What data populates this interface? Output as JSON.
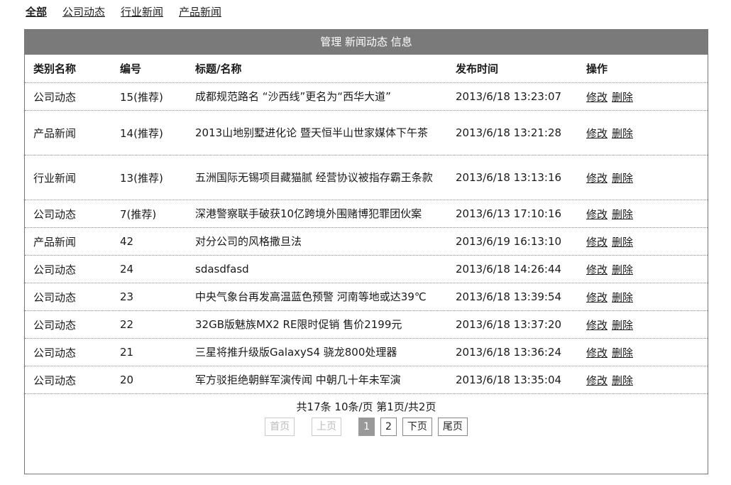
{
  "tabs": [
    "全部",
    "公司动态",
    "行业新闻",
    "产品新闻"
  ],
  "panel_title": "管理 新闻动态 信息",
  "columns": {
    "category": "类别名称",
    "id": "编号",
    "title": "标题/名称",
    "time": "发布时间",
    "ops": "操作"
  },
  "rows": [
    {
      "category": "公司动态",
      "id": "15(推荐)",
      "title": "成都规范路名 “沙西线”更名为“西华大道”",
      "time": "2013/6/18 13:23:07",
      "edit": "修改",
      "delete": "删除"
    },
    {
      "category": "产品新闻",
      "id": "14(推荐)",
      "title": "2013山地别墅进化论 暨天恒半山世家媒体下午茶",
      "time": "2013/6/18 13:21:28",
      "edit": "修改",
      "delete": "删除"
    },
    {
      "category": "行业新闻",
      "id": "13(推荐)",
      "title": "五洲国际无锡项目藏猫腻 经营协议被指存霸王条款",
      "time": "2013/6/18 13:13:16",
      "edit": "修改",
      "delete": "删除"
    },
    {
      "category": "公司动态",
      "id": "7(推荐)",
      "title": "深港警察联手破获10亿跨境外围赌博犯罪团伙案",
      "time": "2013/6/13 17:10:16",
      "edit": "修改",
      "delete": "删除"
    },
    {
      "category": "产品新闻",
      "id": "42",
      "title": "对分公司的风格撒旦法",
      "time": "2013/6/19 16:13:10",
      "edit": "修改",
      "delete": "删除"
    },
    {
      "category": "公司动态",
      "id": "24",
      "title": "sdasdfasd",
      "time": "2013/6/18 14:26:44",
      "edit": "修改",
      "delete": "删除"
    },
    {
      "category": "公司动态",
      "id": "23",
      "title": "中央气象台再发高温蓝色预警 河南等地或达39℃",
      "time": "2013/6/18 13:39:54",
      "edit": "修改",
      "delete": "删除"
    },
    {
      "category": "公司动态",
      "id": "22",
      "title": "32GB版魅族MX2 RE限时促销 售价2199元",
      "time": "2013/6/18 13:37:20",
      "edit": "修改",
      "delete": "删除"
    },
    {
      "category": "公司动态",
      "id": "21",
      "title": "三星将推升级版GalaxyS4 骁龙800处理器",
      "time": "2013/6/18 13:36:24",
      "edit": "修改",
      "delete": "删除"
    },
    {
      "category": "公司动态",
      "id": "20",
      "title": "军方驳拒绝朝鲜军演传闻 中朝几十年未军演",
      "time": "2013/6/18 13:35:04",
      "edit": "修改",
      "delete": "删除"
    }
  ],
  "pager": {
    "summary": "共17条 10条/页 第1页/共2页",
    "first": "首页",
    "prev": "上页",
    "page1": "1",
    "page2": "2",
    "next": "下页",
    "last": "尾页"
  }
}
